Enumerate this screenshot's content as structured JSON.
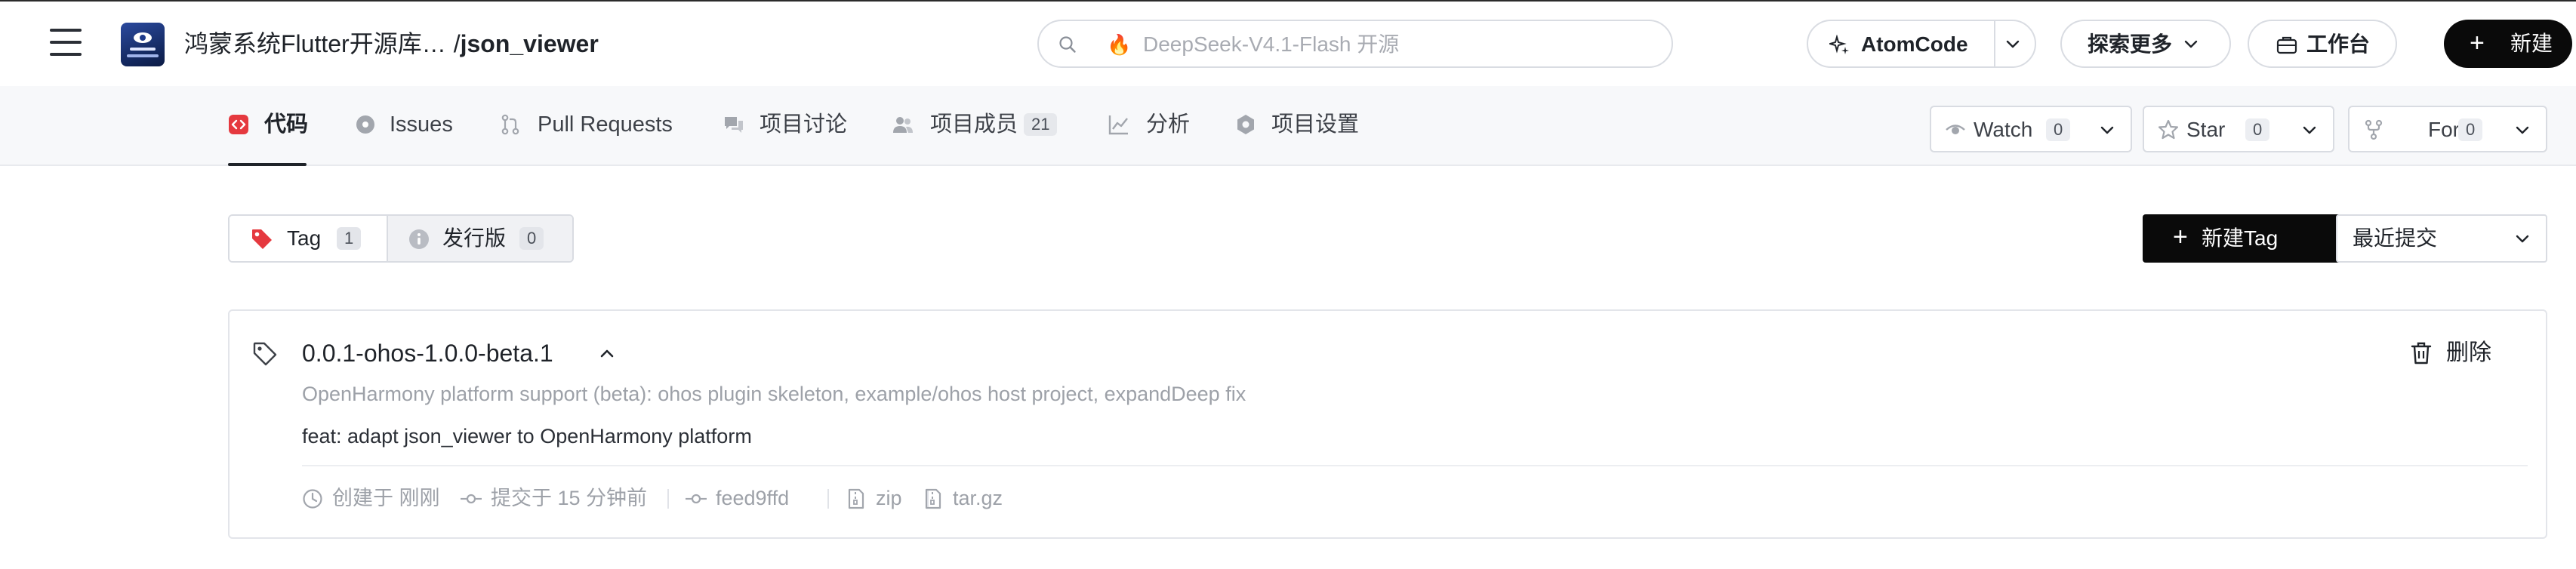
{
  "header": {
    "repo_owner": "鸿蒙系统Flutter开源库…",
    "repo_sep": "/",
    "repo_name": "json_viewer",
    "search_placeholder": "DeepSeek-V4.1-Flash 开源",
    "search_badge_icon": "fire-icon",
    "atomcode_label": "AtomCode",
    "explore_label": "探索更多",
    "workbench_label": "工作台",
    "new_label": "新建"
  },
  "tabs": [
    {
      "label": "代码",
      "icon": "code-icon",
      "active": true
    },
    {
      "label": "Issues",
      "icon": "issue-icon"
    },
    {
      "label": "Pull Requests",
      "icon": "pull-request-icon"
    },
    {
      "label": "项目讨论",
      "icon": "discussion-icon"
    },
    {
      "label": "项目成员",
      "icon": "members-icon",
      "count": "21"
    },
    {
      "label": "分析",
      "icon": "chart-icon"
    },
    {
      "label": "项目设置",
      "icon": "settings-icon"
    }
  ],
  "social": {
    "watch_label": "Watch",
    "watch_count": "0",
    "star_label": "Star",
    "star_count": "0",
    "fork_label": "Fork",
    "fork_count": "0"
  },
  "releases": {
    "tag_label": "Tag",
    "tag_count": "1",
    "release_label": "发行版",
    "release_count": "0",
    "new_tag_label": "新建Tag",
    "sort_label": "最近提交"
  },
  "tag": {
    "name": "0.0.1-ohos-1.0.0-beta.1",
    "description": "OpenHarmony platform support (beta): ohos plugin skeleton, example/ohos host project, expandDeep fix",
    "commit_message": "feat: adapt json_viewer to OpenHarmony platform",
    "delete_label": "删除",
    "created": "创建于 刚刚",
    "committed": "提交于 15 分钟前",
    "commit_sha": "feed9ffd",
    "zip_label": "zip",
    "targz_label": "tar.gz"
  },
  "colors": {
    "accent_dark": "#0a0a0a",
    "code_tab_icon": "#e5393f",
    "tag_red": "#e5393f",
    "muted_text": "#9da1a8"
  }
}
